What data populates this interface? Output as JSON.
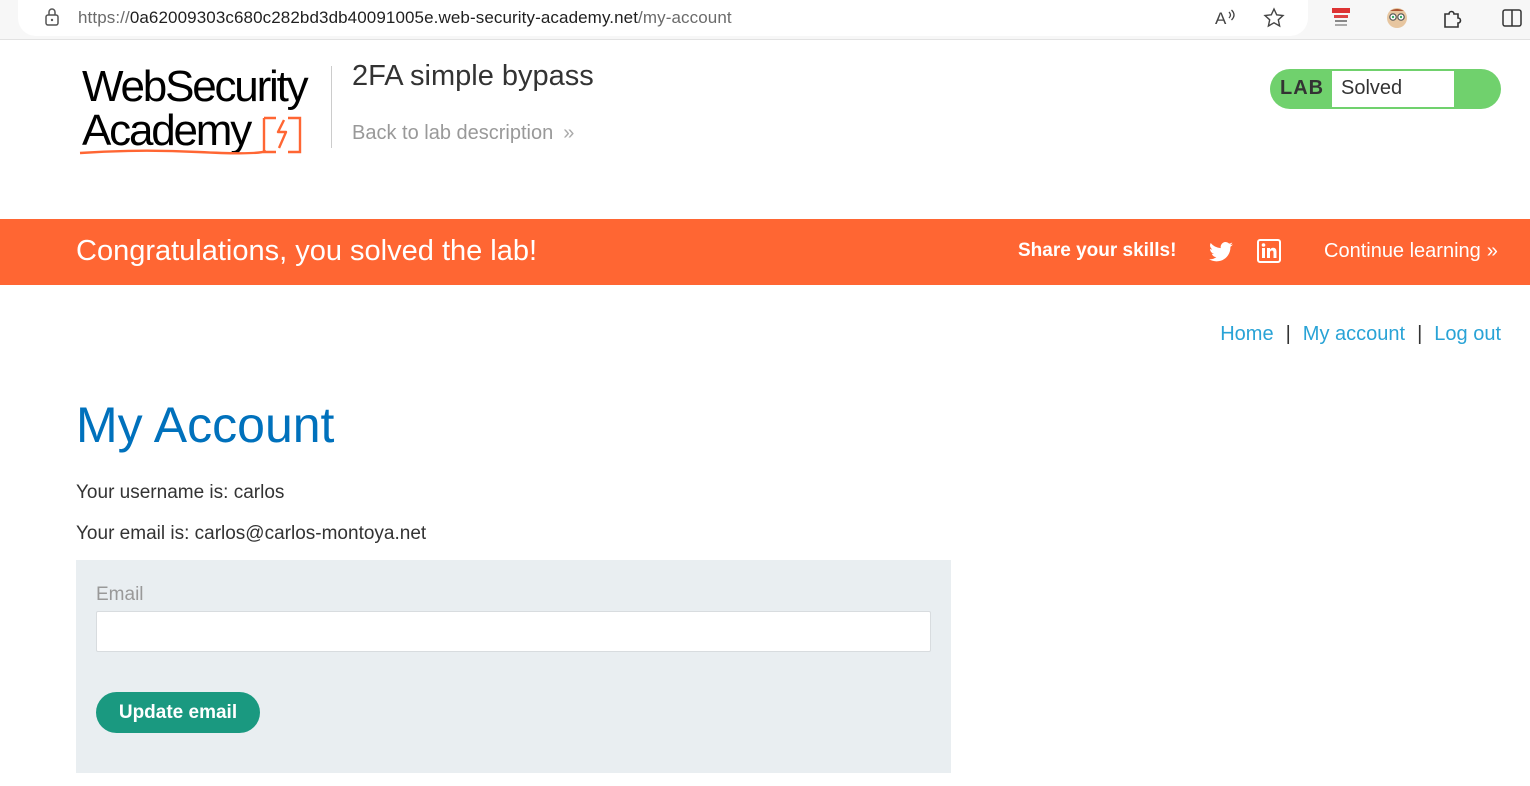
{
  "browser": {
    "url_scheme": "https://",
    "url_host": "0a62009303c680c282bd3db40091005e.web-security-academy.net",
    "url_path": "/my-account"
  },
  "header": {
    "logo_line1": "WebSecurity",
    "logo_line2": "Academy",
    "lab_title": "2FA simple bypass",
    "back_link": "Back to lab description",
    "lab_tag": "LAB",
    "lab_status": "Solved",
    "status_color": "#70d16d"
  },
  "banner": {
    "message": "Congratulations, you solved the lab!",
    "share": "Share your skills!",
    "continue": "Continue learning",
    "color": "#ff6633"
  },
  "nav": {
    "home": "Home",
    "my_account": "My account",
    "logout": "Log out",
    "separator": "|"
  },
  "main": {
    "title": "My Account",
    "username_line": "Your username is: carlos",
    "email_line": "Your email is: carlos@carlos-montoya.net",
    "form": {
      "email_label": "Email",
      "email_value": "",
      "button": "Update email"
    }
  }
}
